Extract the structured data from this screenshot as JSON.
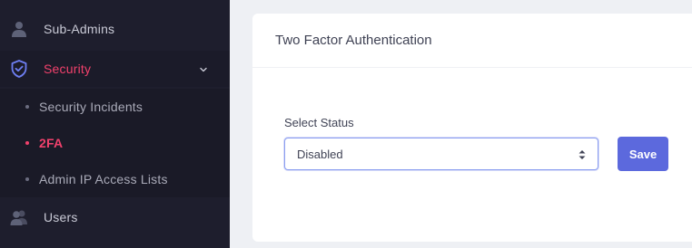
{
  "sidebar": {
    "items": [
      {
        "label": "Sub-Admins",
        "icon": "user-icon"
      },
      {
        "label": "Security",
        "icon": "shield-icon",
        "active": true,
        "expanded": true
      },
      {
        "label": "Users",
        "icon": "users-icon"
      }
    ],
    "security_submenu": [
      {
        "label": "Security Incidents"
      },
      {
        "label": "2FA",
        "active": true
      },
      {
        "label": "Admin IP Access Lists"
      }
    ]
  },
  "card": {
    "title": "Two Factor Authentication",
    "field_label": "Select Status",
    "select_value": "Disabled",
    "save_label": "Save"
  },
  "colors": {
    "sidebar_bg": "#1e1e2d",
    "active_accent": "#f1416c",
    "primary_button": "#5c69dd"
  }
}
